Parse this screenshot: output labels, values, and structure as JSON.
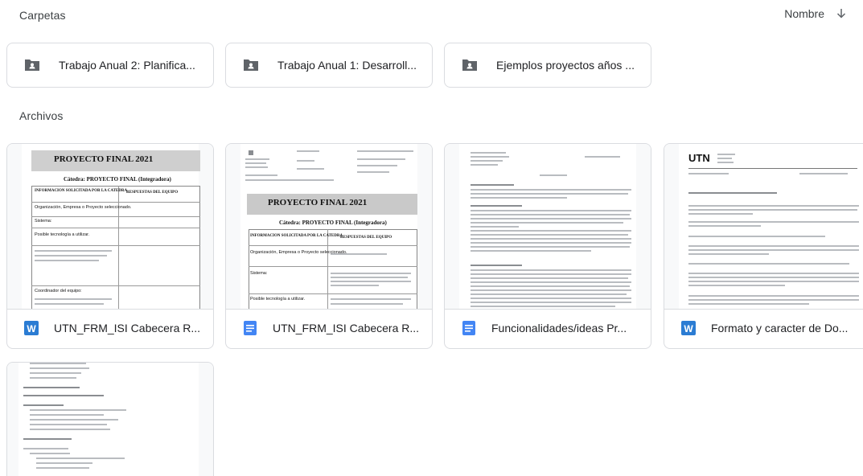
{
  "header": {
    "folders_title": "Carpetas",
    "files_title": "Archivos",
    "sort_label": "Nombre"
  },
  "folders": [
    {
      "name": "Trabajo Anual 2: Planifica..."
    },
    {
      "name": "Trabajo Anual 1: Desarroll..."
    },
    {
      "name": "Ejemplos proyectos años ..."
    }
  ],
  "files": [
    {
      "name": "UTN_FRM_ISI Cabecera R...",
      "type_icon": "word-icon"
    },
    {
      "name": "UTN_FRM_ISI Cabecera R...",
      "type_icon": "google-docs-icon"
    },
    {
      "name": "Funcionalidades/ideas Pr...",
      "type_icon": "google-docs-icon"
    },
    {
      "name": "Formato y caracter de Do...",
      "type_icon": "word-icon"
    }
  ],
  "thumbnails": {
    "proyecto_banner": "PROYECTO FINAL 2021",
    "catedra": "Cátedra: PROYECTO FINAL (Integradora)",
    "info_header": "INFORMACION SOLICITADA POR LA CATEDRA",
    "resp_header": "RESPUESTAS DEL EQUIPO",
    "row_org": "Organización, Empresa o Proyecto seleccionado.",
    "row_sistema": "Sistema:",
    "row_tecno": "Posible tecnología a utilizar.",
    "row_estim": "Estimación de clases, partes o módulos del Sistema (posible alcance funcional del Sistema).",
    "row_coord": "Coordinador del equipo:",
    "utn_logo": "UTN"
  },
  "colors": {
    "folder_icon": "#5f6368",
    "word_blue": "#2b7cd3",
    "docs_blue": "#4285f4",
    "border": "#dadce0"
  }
}
